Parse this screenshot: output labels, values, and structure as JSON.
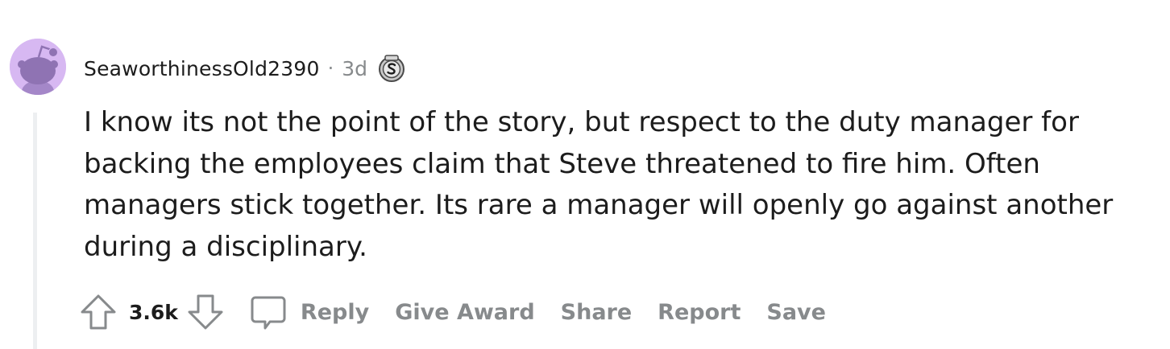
{
  "comment": {
    "username": "SeaworthinessOld2390",
    "separator": "·",
    "time": "3d",
    "avatar_icon": "snoo-avatar-icon",
    "flair_icon": "silver-award-icon",
    "body": "I know its not the point of the story, but respect to the duty manager for backing the employees claim that Steve threatened to fire him. Often managers stick together. Its rare a manager will openly go against another during a disciplinary."
  },
  "actions": {
    "upvote_icon": "upvote-arrow-icon",
    "vote_count": "3.6k",
    "downvote_icon": "downvote-arrow-icon",
    "comment_icon": "comment-bubble-icon",
    "reply_label": "Reply",
    "give_award_label": "Give Award",
    "share_label": "Share",
    "report_label": "Report",
    "save_label": "Save"
  },
  "colors": {
    "text_primary": "#1c1c1c",
    "text_muted": "#878a8c",
    "avatar_bg": "#d7b8f2",
    "thread_line": "#edeff1"
  }
}
